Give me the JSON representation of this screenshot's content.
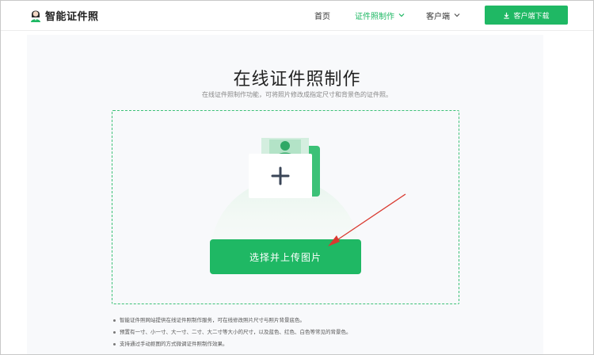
{
  "header": {
    "logo_text": "智能证件照",
    "nav": [
      {
        "label": "首页"
      },
      {
        "label": "证件照制作"
      },
      {
        "label": "客户端"
      }
    ],
    "download_label": "客户端下载"
  },
  "main": {
    "title": "在线证件照制作",
    "subtitle": "在线证件照制作功能，可将照片修改成指定尺寸和背景色的证件照。",
    "upload_button": "选择并上传图片",
    "notes": [
      "智能证件照网站提供在线证件照制作服务，可在线修改照片尺寸与照片背景底色。",
      "预置有一寸、小一寸、大一寸、二寸、大二寸等大小的尺寸，以及蓝色、红色、白色等常见的背景色。",
      "支持通过手动抠图的方式微调证件照制作效果。"
    ]
  },
  "colors": {
    "accent": "#1fb864",
    "dashed_border": "#3cc177",
    "annotation_arrow": "#d9392f"
  },
  "icons": {
    "logo": "person-avatar-icon",
    "chevron": "chevron-down-icon",
    "download": "download-icon",
    "upload_illustration": "id-photo-plus-icon"
  }
}
